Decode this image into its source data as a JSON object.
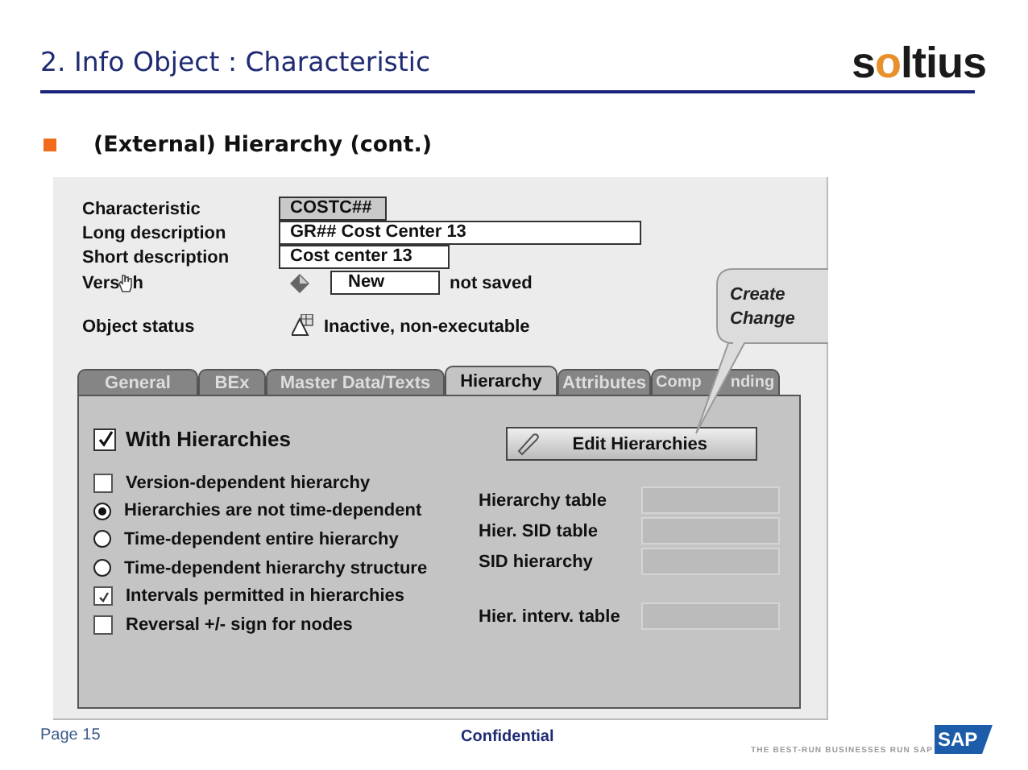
{
  "slide": {
    "title": "2. Info Object : Characteristic",
    "logo_parts": [
      {
        "text": "s",
        "color": "#1a1a1a"
      },
      {
        "text": "o",
        "color": "#e8912c"
      },
      {
        "text": "ltius",
        "color": "#1a1a1a"
      }
    ],
    "bullet": "(External) Hierarchy (cont.)"
  },
  "form": {
    "rows": [
      {
        "kind": "boxed",
        "label": "Characteristic",
        "value": "COSTC##"
      },
      {
        "kind": "field",
        "label": "Long description",
        "value": "GR## Cost Center 13"
      },
      {
        "kind": "field",
        "label": "Short description",
        "value": "Cost center 13"
      },
      {
        "kind": "version",
        "label": "Vers",
        "label_end": "h",
        "value": "New",
        "note": "not saved"
      },
      {
        "kind": "status",
        "label": "Object status",
        "value": "Inactive, non-executable"
      }
    ]
  },
  "callout": {
    "lines": [
      "Create",
      "Change"
    ]
  },
  "tabs": [
    {
      "label": "General",
      "selected": false
    },
    {
      "label": "BEx",
      "selected": false
    },
    {
      "label": "Master Data/Texts",
      "selected": false
    },
    {
      "label": "Hierarchy",
      "selected": true
    },
    {
      "label": "Attributes",
      "selected": false
    },
    {
      "label": "Comp",
      "label_end": "nding",
      "selected": false
    }
  ],
  "hierarchy_tab": {
    "with_hierarchies": {
      "label": "With Hierarchies",
      "checked": true
    },
    "edit_button": "Edit Hierarchies",
    "options": [
      {
        "kind": "checkbox",
        "label": "Version-dependent hierarchy",
        "checked": false
      },
      {
        "kind": "radio",
        "label": "Hierarchies are not time-dependent",
        "selected": true
      },
      {
        "kind": "radio",
        "label": "Time-dependent entire hierarchy",
        "selected": false
      },
      {
        "kind": "radio",
        "label": "Time-dependent hierarchy structure",
        "selected": false
      },
      {
        "kind": "checkbox",
        "label": "Intervals permitted in hierarchies",
        "checked": true
      },
      {
        "kind": "checkbox",
        "label": "Reversal +/- sign for nodes",
        "checked": false
      }
    ],
    "tables": [
      {
        "label": "Hierarchy table"
      },
      {
        "label": "Hier. SID table"
      },
      {
        "label": "SID hierarchy"
      },
      {
        "label": "Hier. interv. table",
        "kind": "spaced"
      }
    ]
  },
  "footer": {
    "page": "Page 15",
    "confidential": "Confidential",
    "tagline": "THE BEST-RUN BUSINESSES RUN SAP",
    "sap_logo": "SAP"
  }
}
